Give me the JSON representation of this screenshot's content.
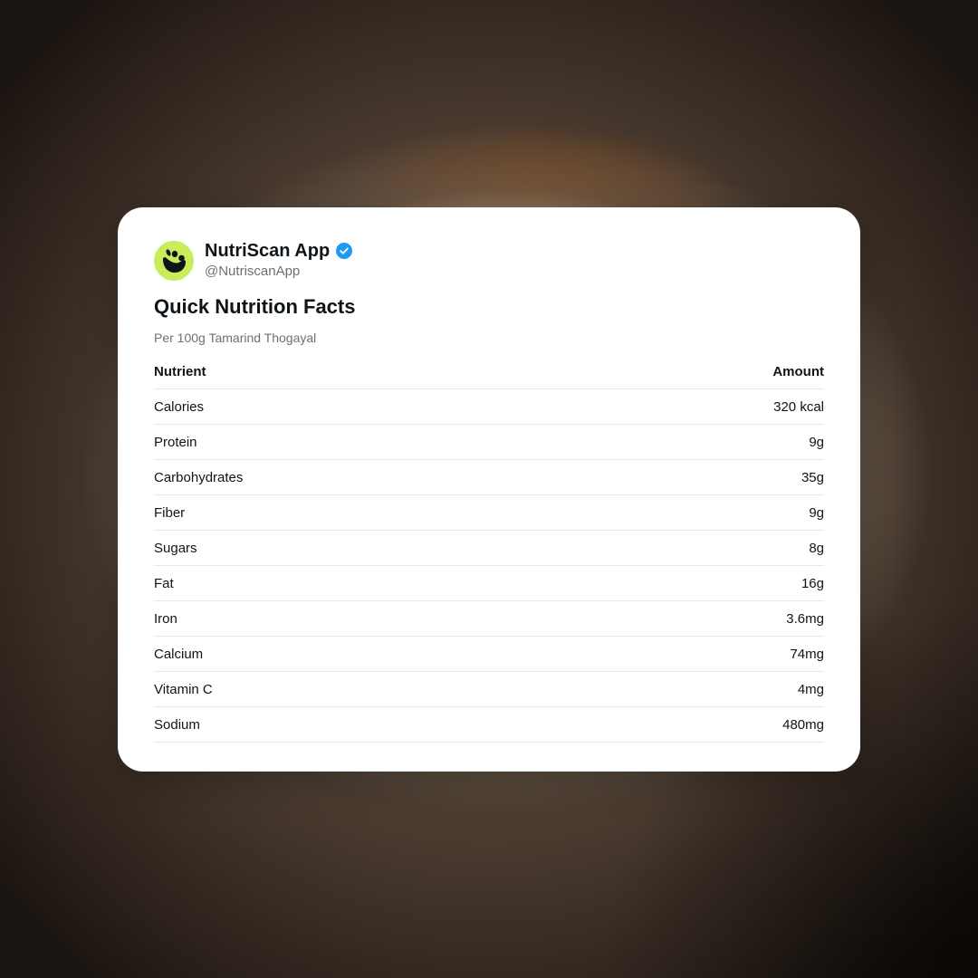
{
  "post": {
    "app_name": "NutriScan App",
    "handle": "@NutriscanApp",
    "verified": true,
    "avatar_color": "#c9ec58",
    "avatar_icon": "leaf-bowl-logo-icon",
    "verified_color": "#1d9bf0"
  },
  "card": {
    "title": "Quick Nutrition Facts",
    "subtitle": "Per 100g Tamarind Thogayal"
  },
  "table": {
    "headers": {
      "nutrient": "Nutrient",
      "amount": "Amount"
    },
    "rows": [
      {
        "nutrient": "Calories",
        "amount": "320 kcal"
      },
      {
        "nutrient": "Protein",
        "amount": "9g"
      },
      {
        "nutrient": "Carbohydrates",
        "amount": "35g"
      },
      {
        "nutrient": "Fiber",
        "amount": "9g"
      },
      {
        "nutrient": "Sugars",
        "amount": "8g"
      },
      {
        "nutrient": "Fat",
        "amount": "16g"
      },
      {
        "nutrient": "Iron",
        "amount": "3.6mg"
      },
      {
        "nutrient": "Calcium",
        "amount": "74mg"
      },
      {
        "nutrient": "Vitamin C",
        "amount": "4mg"
      },
      {
        "nutrient": "Sodium",
        "amount": "480mg"
      }
    ]
  }
}
